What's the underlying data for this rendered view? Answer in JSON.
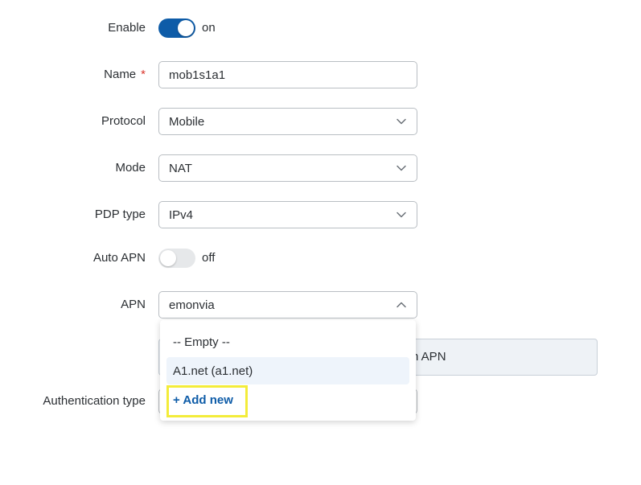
{
  "enable": {
    "label": "Enable",
    "state_text": "on",
    "on": true
  },
  "name": {
    "label": "Name",
    "required_mark": "*",
    "value": "mob1s1a1"
  },
  "protocol": {
    "label": "Protocol",
    "value": "Mobile"
  },
  "mode": {
    "label": "Mode",
    "value": "NAT"
  },
  "pdp_type": {
    "label": "PDP type",
    "value": "IPv4"
  },
  "auto_apn": {
    "label": "Auto APN",
    "state_text": "off",
    "on": false
  },
  "apn": {
    "label": "APN",
    "value": "emonvia",
    "options": [
      "-- Empty --",
      "A1.net (a1.net)",
      "+ Add new"
    ],
    "hovered_option": "A1.net (a1.net)",
    "highlighted_option": "+ Add new"
  },
  "hidden_row_text": "n APN",
  "authentication_type": {
    "label": "Authentication type"
  },
  "colors": {
    "accent": "#0e5ca8",
    "required": "#d9342b",
    "highlight": "#f3ec3a",
    "hover": "#eef4fb"
  },
  "icons": [
    "chevron-down-icon",
    "chevron-up-icon"
  ]
}
